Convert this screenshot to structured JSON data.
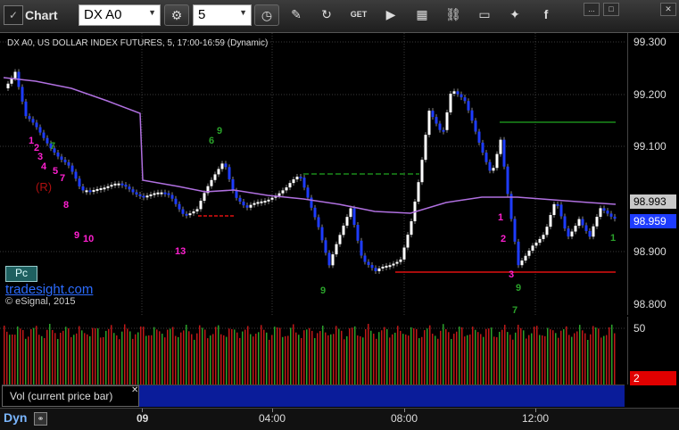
{
  "toolbar": {
    "logo_label": "✓",
    "title": "Chart",
    "symbol": "DX A0",
    "interval": "5",
    "window_controls": [
      "...",
      "□",
      "✕"
    ]
  },
  "chart": {
    "header": "DX A0, US DOLLAR INDEX FUTURES, 5, 17:00-16:59 (Dynamic)",
    "badge": "Pc",
    "brand": "tradesight.com",
    "copyright": "© eSignal, 2015",
    "annotation_r": "(R)",
    "price_ticks": [
      "99.300",
      "99.200",
      "99.100",
      "98.993",
      "98.900",
      "98.800"
    ],
    "last_price": "98.959",
    "vwap_tag": "98.993",
    "colors": {
      "up": "#ffffff",
      "down": "#1e3cff",
      "vwap": "#b070e0",
      "support": "#e01010",
      "resistance": "#1a8a1a",
      "count_magenta": "#ff20d0",
      "count_green": "#2aa12a",
      "bg": "#000000"
    }
  },
  "counts": [
    {
      "t": "1",
      "c": "m"
    },
    {
      "t": "2",
      "c": "m"
    },
    {
      "t": "3",
      "c": "m"
    },
    {
      "t": "4",
      "c": "m"
    },
    {
      "t": "5",
      "c": "m"
    },
    {
      "t": "7",
      "c": "m"
    },
    {
      "t": "8",
      "c": "m"
    },
    {
      "t": "9",
      "c": "m"
    },
    {
      "t": "10",
      "c": "m"
    },
    {
      "t": "13",
      "c": "m"
    },
    {
      "t": "1",
      "c": "m"
    },
    {
      "t": "2",
      "c": "m"
    },
    {
      "t": "3",
      "c": "m"
    },
    {
      "t": "9",
      "c": "g"
    },
    {
      "t": "6",
      "c": "g"
    },
    {
      "t": "9",
      "c": "g"
    },
    {
      "t": "7",
      "c": "g"
    },
    {
      "t": "9",
      "c": "g"
    },
    {
      "t": "1",
      "c": "g"
    },
    {
      "t": "7",
      "c": "g"
    }
  ],
  "volume": {
    "label": "Vol (current price bar)",
    "close_glyph": "✕",
    "axis_tick": "50",
    "current_tag": "2"
  },
  "time_axis": {
    "mode": "Dyn",
    "link_glyph": "⚭",
    "labels": [
      "09",
      "04:00",
      "08:00",
      "12:00"
    ]
  }
}
